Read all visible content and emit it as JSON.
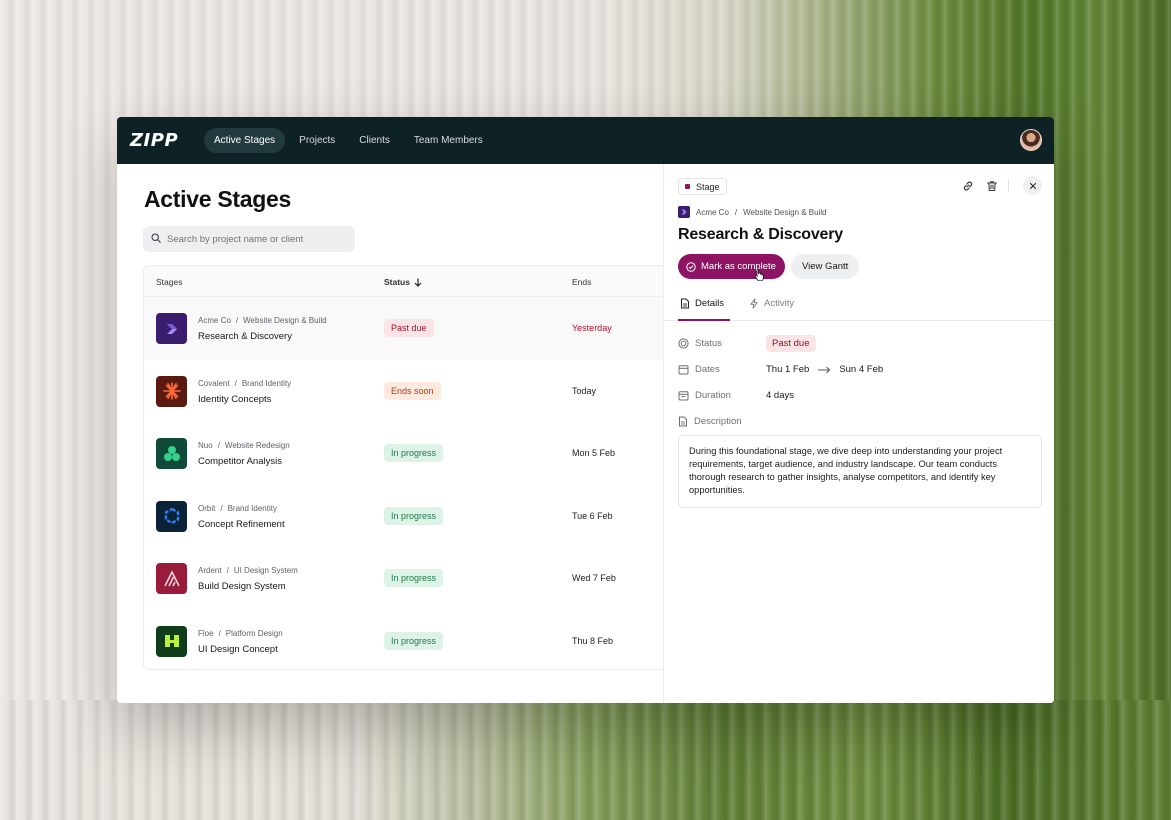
{
  "app": {
    "logo": "ZIPP",
    "nav": [
      "Active Stages",
      "Projects",
      "Clients",
      "Team Members"
    ]
  },
  "list": {
    "title": "Active Stages",
    "search_placeholder": "Search by project name or client",
    "columns": {
      "stages": "Stages",
      "status": "Status",
      "ends": "Ends"
    },
    "rows": [
      {
        "client": "Acme Co",
        "project": "Website Design & Build",
        "name": "Research & Discovery",
        "status": "Past due",
        "ends": "Yesterday",
        "icon": "acme-logo-icon",
        "color": "#3b1d6e"
      },
      {
        "client": "Covalent",
        "project": "Brand Identity",
        "name": "Identity Concepts",
        "status": "Ends soon",
        "ends": "Today",
        "icon": "covalent-logo-icon",
        "color": "#5a1a10"
      },
      {
        "client": "Nuo",
        "project": "Website Redesign",
        "name": "Competitor Analysis",
        "status": "In progress",
        "ends": "Mon 5 Feb",
        "icon": "nuo-logo-icon",
        "color": "#0f4a3a"
      },
      {
        "client": "Orbit",
        "project": "Brand Identity",
        "name": "Concept Refinement",
        "status": "In progress",
        "ends": "Tue 6 Feb",
        "icon": "orbit-logo-icon",
        "color": "#0c2236"
      },
      {
        "client": "Ardent",
        "project": "UI Design System",
        "name": "Build Design System",
        "status": "In progress",
        "ends": "Wed 7 Feb",
        "icon": "ardent-logo-icon",
        "color": "#9a1c3c"
      },
      {
        "client": "Floe",
        "project": "Platform Design",
        "name": "UI Design Concept",
        "status": "In progress",
        "ends": "Thu 8 Feb",
        "icon": "floe-logo-icon",
        "color": "#0f3d1c"
      }
    ]
  },
  "panel": {
    "chip": "Stage",
    "crumb_client": "Acme Co",
    "crumb_sep": "/",
    "crumb_project": "Website Design & Build",
    "title": "Research & Discovery",
    "primary_button": "Mark as complete",
    "secondary_button": "View Gantt",
    "tabs": [
      "Details",
      "Activity"
    ],
    "status_label": "Status",
    "status_value": "Past due",
    "dates_label": "Dates",
    "date_start": "Thu 1 Feb",
    "date_end": "Sun 4 Feb",
    "duration_label": "Duration",
    "duration_value": "4 days",
    "description_label": "Description",
    "description": "During this foundational stage, we dive deep into understanding your project requirements, target audience, and industry landscape. Our team conducts thorough research to gather insights, analyse competitors, and identify key opportunities."
  },
  "colors": {
    "accent": "#8e1463",
    "topbar": "#0e2226",
    "past_due": "#a0192d",
    "ends_soon": "#a8411a",
    "in_progress": "#1e7a4a"
  }
}
